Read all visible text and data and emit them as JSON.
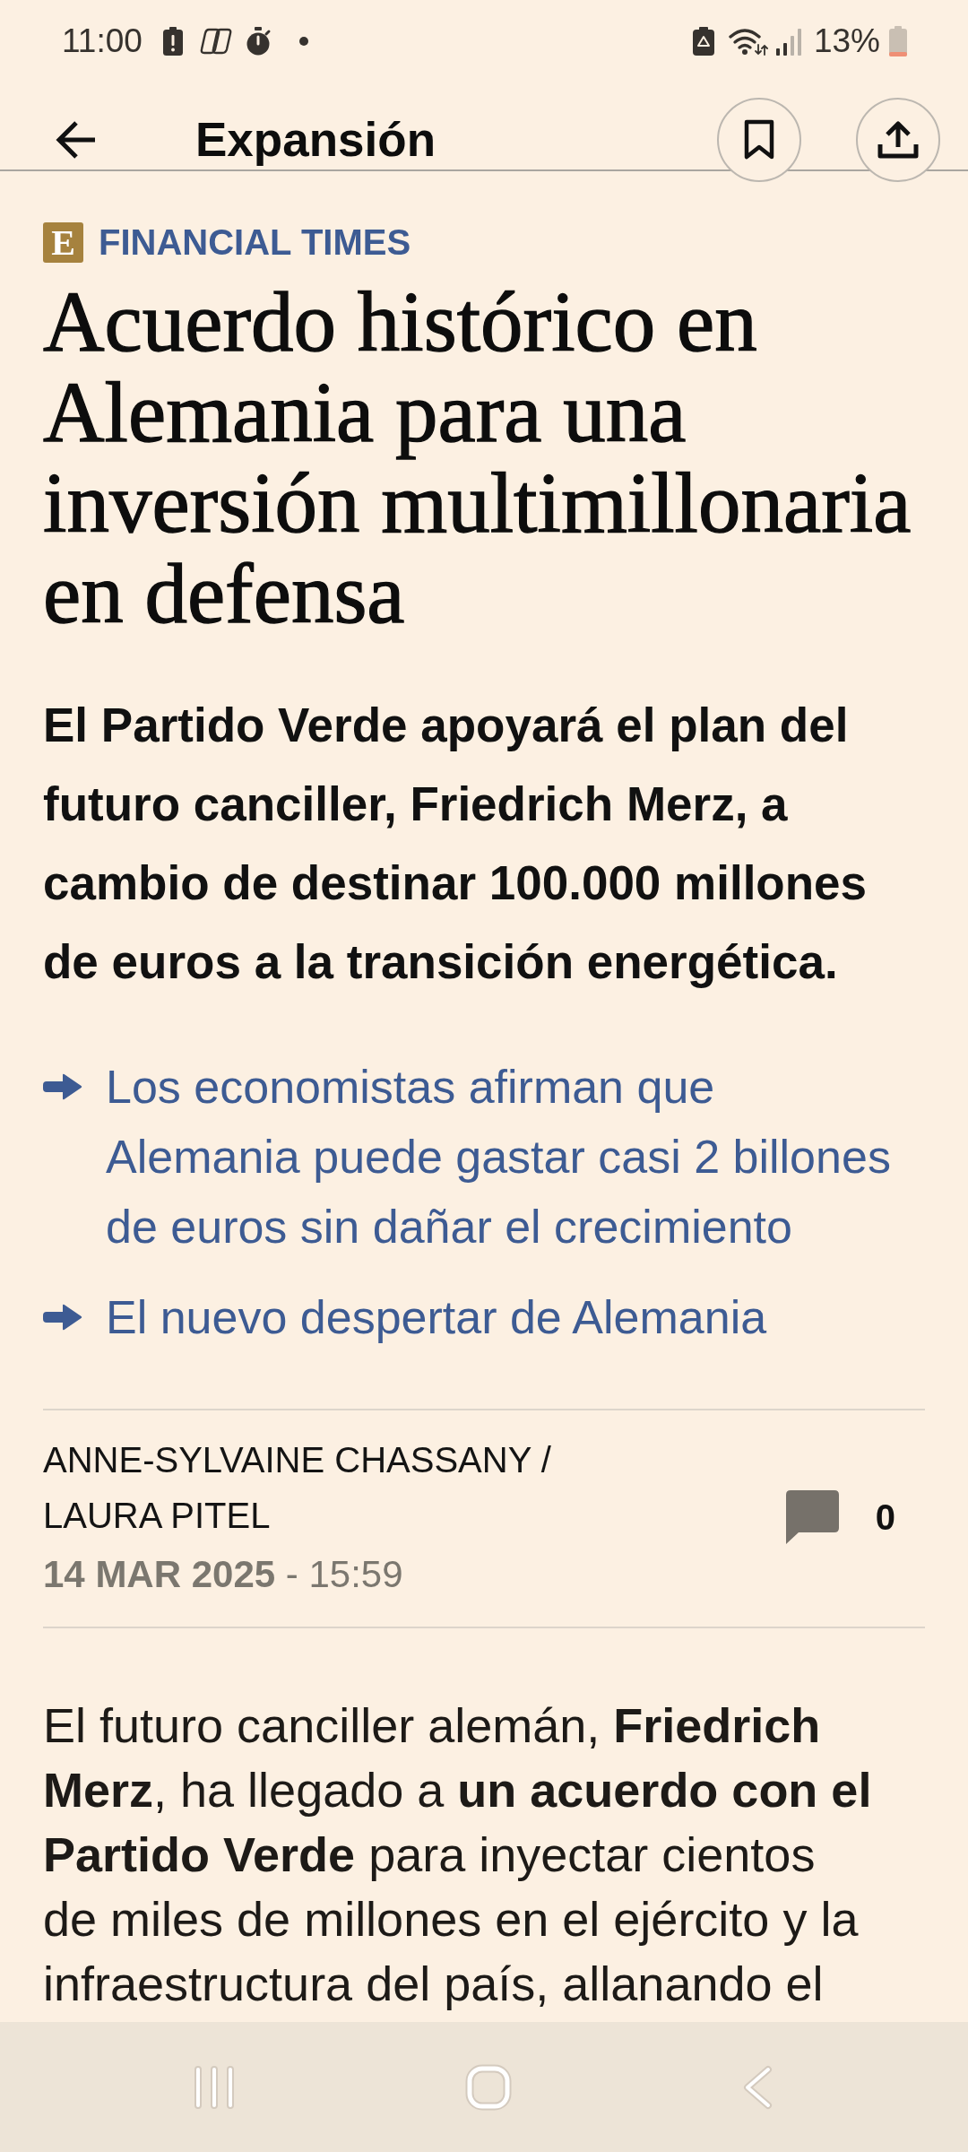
{
  "status_bar": {
    "time": "11:00",
    "battery": "13%"
  },
  "header": {
    "title": "Expansión"
  },
  "article": {
    "source": {
      "logo": "E",
      "name": "FINANCIAL TIMES"
    },
    "title": "Acuerdo histórico en Alemania para una inversión multimillonaria en defensa",
    "subtitle": "El Partido Verde apoyará el plan del futuro canciller, Friedrich Merz, a cambio de destinar 100.000 millones de euros a la transición energética.",
    "related_links": [
      "Los economistas afirman que Alemania puede gastar casi 2 billones de euros sin dañar el crecimiento",
      "El nuevo despertar de Alemania"
    ],
    "authors": "ANNE-SYLVAINE CHASSANY / LAURA PITEL",
    "published": "**14 MAR 2025** - 15:59",
    "comments": "0",
    "body": "El futuro canciller alemán, **Friedrich Merz**, ha llegado a **un acuerdo con el Partido Verde** para inyectar cientos de miles de millones en el ejército y la infraestructura del país, allanando el"
  }
}
